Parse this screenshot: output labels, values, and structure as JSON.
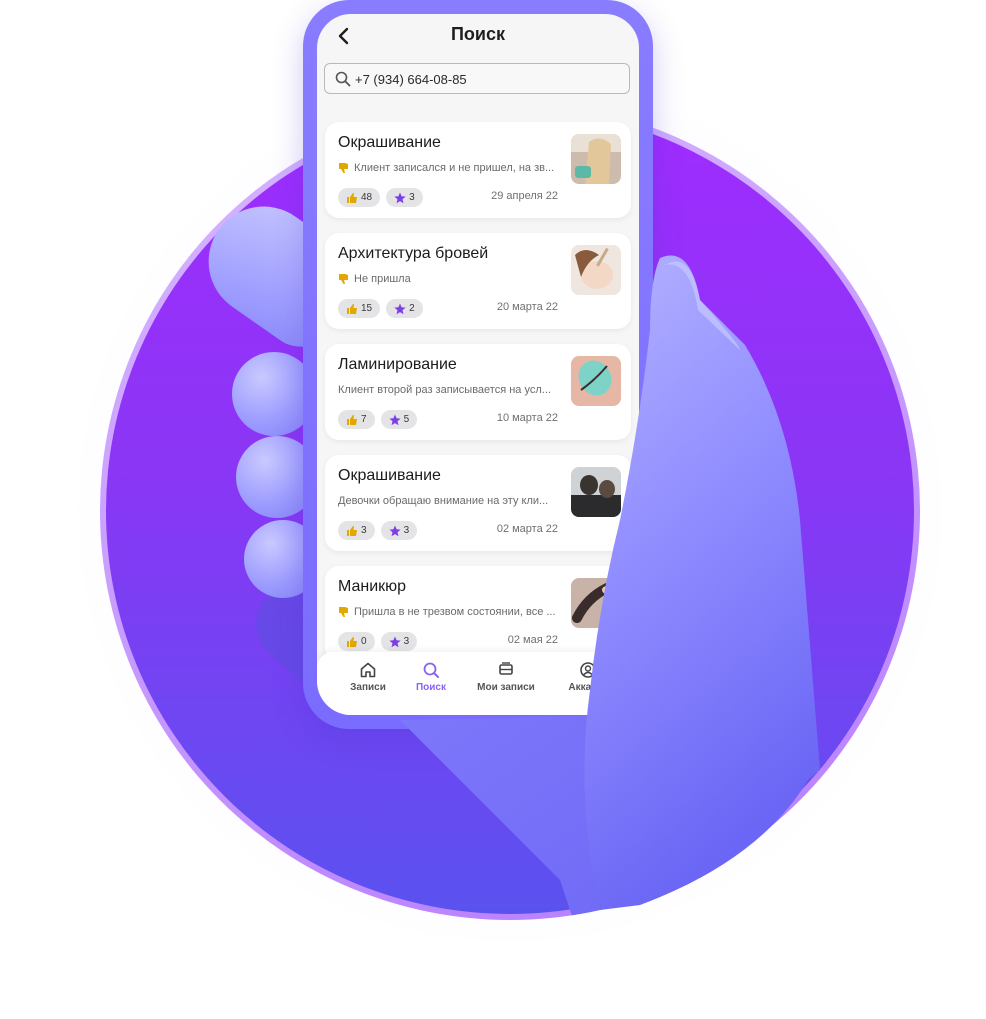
{
  "screen": {
    "title": "Поиск"
  },
  "search": {
    "value": "+7 (934) 664-08-85",
    "placeholder": ""
  },
  "records": [
    {
      "title": "Окрашивание",
      "comment": "Клиент записался и не пришел, на зв...",
      "likes": "48",
      "stars": "3",
      "date": "29 апреля 22",
      "has_dislike": true
    },
    {
      "title": "Архитектура бровей",
      "comment": "Не пришла",
      "likes": "15",
      "stars": "2",
      "date": "20 марта 22",
      "has_dislike": true
    },
    {
      "title": "Ламинирование",
      "comment": "Клиент второй раз записывается на усл...",
      "likes": "7",
      "stars": "5",
      "date": "10 марта 22",
      "has_dislike": false
    },
    {
      "title": "Окрашивание",
      "comment": "Девочки обращаю внимание на эту кли...",
      "likes": "3",
      "stars": "3",
      "date": "02 марта 22",
      "has_dislike": false
    },
    {
      "title": "Маникюр",
      "comment": "Пришла в не трезвом состоянии, все ...",
      "likes": "0",
      "stars": "3",
      "date": "02 мая 22",
      "has_dislike": true
    }
  ],
  "tabbar": {
    "items": [
      {
        "label": "Записи",
        "icon": "home-icon",
        "active": false
      },
      {
        "label": "Поиск",
        "icon": "search-icon",
        "active": true
      },
      {
        "label": "Мои записи",
        "icon": "records-icon",
        "active": false
      },
      {
        "label": "Аккаунт",
        "icon": "account-icon",
        "active": false
      }
    ]
  },
  "colors": {
    "accent": "#8a63f0",
    "circle_top": "#a02cff",
    "circle_bottom": "#5a52ef",
    "hand": "#8f8cff",
    "star": "#7b3fe4",
    "like": "#e0a800"
  }
}
